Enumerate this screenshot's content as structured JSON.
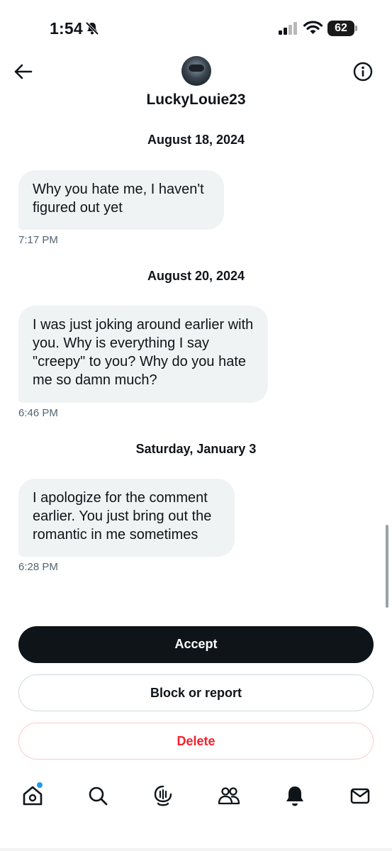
{
  "status_bar": {
    "time": "1:54",
    "battery": "62"
  },
  "header": {
    "username": "LuckyLouie23",
    "icons": [
      "back-arrow-icon",
      "avatar",
      "info-icon"
    ]
  },
  "conversation": [
    {
      "date": "August 18, 2024",
      "text": "Why you hate me, I haven't figured out yet",
      "time": "7:17 PM"
    },
    {
      "date": "August 20, 2024",
      "text": "I was just joking around earlier with you. Why is everything I say \"creepy\" to you? Why do you hate me so damn much?",
      "time": "6:46 PM"
    },
    {
      "date": "Saturday, January 3",
      "text": "I apologize for the comment earlier. You just bring out the romantic in me sometimes",
      "time": "6:28 PM"
    }
  ],
  "actions": {
    "accept": "Accept",
    "block": "Block or report",
    "delete": "Delete"
  },
  "bottom_nav": {
    "items": [
      "home-icon",
      "search-icon",
      "grok-icon",
      "communities-icon",
      "notifications-icon",
      "messages-icon"
    ],
    "home_has_dot": true
  },
  "colors": {
    "primary_button": "#0f1419",
    "delete_red": "#f4212e",
    "notification_dot": "#1d9bf0",
    "bubble_bg": "#eff3f4"
  }
}
